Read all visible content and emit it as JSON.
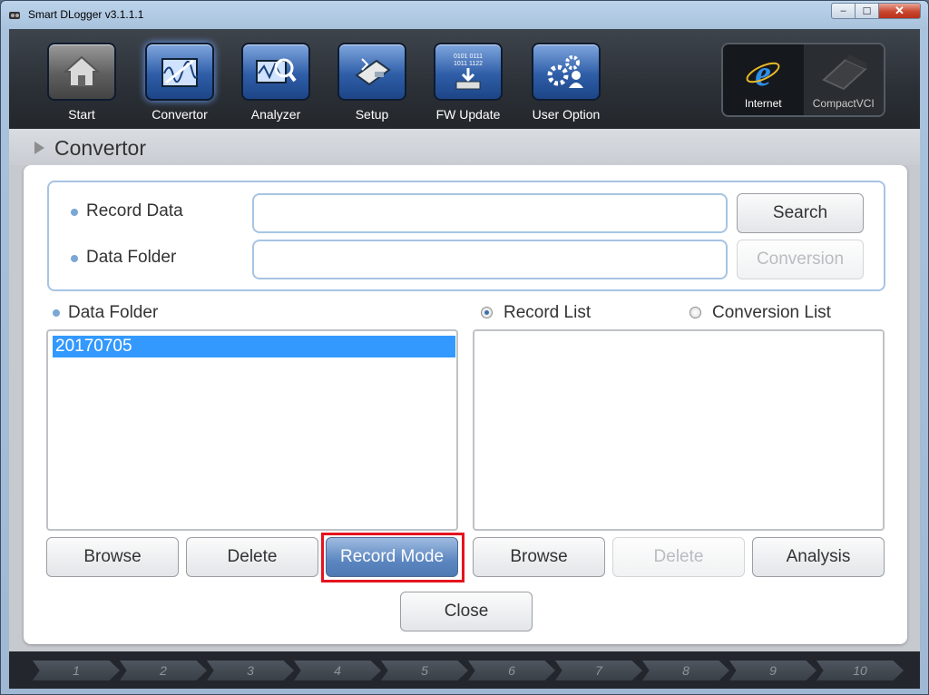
{
  "window": {
    "title": "Smart DLogger v3.1.1.1",
    "close_glyph": "✕",
    "minimize_glyph": "–",
    "maximize_glyph": "☐"
  },
  "toolbar": {
    "items": [
      {
        "label": "Start",
        "icon": "home-icon"
      },
      {
        "label": "Convertor",
        "icon": "convertor-icon"
      },
      {
        "label": "Analyzer",
        "icon": "analyzer-icon"
      },
      {
        "label": "Setup",
        "icon": "setup-icon"
      },
      {
        "label": "FW Update",
        "icon": "fw-update-icon",
        "icon_text": [
          "0101 0111",
          "1011 1122"
        ]
      },
      {
        "label": "User Option",
        "icon": "user-option-icon"
      }
    ],
    "side": [
      {
        "label": "Internet",
        "icon": "internet-explorer-icon"
      },
      {
        "label": "CompactVCI",
        "icon": "compactvci-icon"
      }
    ]
  },
  "section": {
    "title": "Convertor"
  },
  "form": {
    "record_data_label": "Record Data",
    "record_data_value": "",
    "data_folder_label": "Data Folder",
    "data_folder_value": "",
    "search_label": "Search",
    "conversion_label": "Conversion"
  },
  "left_list": {
    "title": "Data Folder",
    "items": [
      "20170705"
    ],
    "browse_label": "Browse",
    "delete_label": "Delete",
    "record_mode_label": "Record Mode"
  },
  "right_list": {
    "record_list_label": "Record List",
    "conversion_list_label": "Conversion List",
    "selected": "Record List",
    "browse_label": "Browse",
    "delete_label": "Delete",
    "analysis_label": "Analysis"
  },
  "close_label": "Close",
  "steps": [
    "1",
    "2",
    "3",
    "4",
    "5",
    "6",
    "7",
    "8",
    "9",
    "10"
  ],
  "colors": {
    "accent": "#3399ff",
    "highlight": "#e4141e",
    "field_border": "#a7c4e3"
  }
}
